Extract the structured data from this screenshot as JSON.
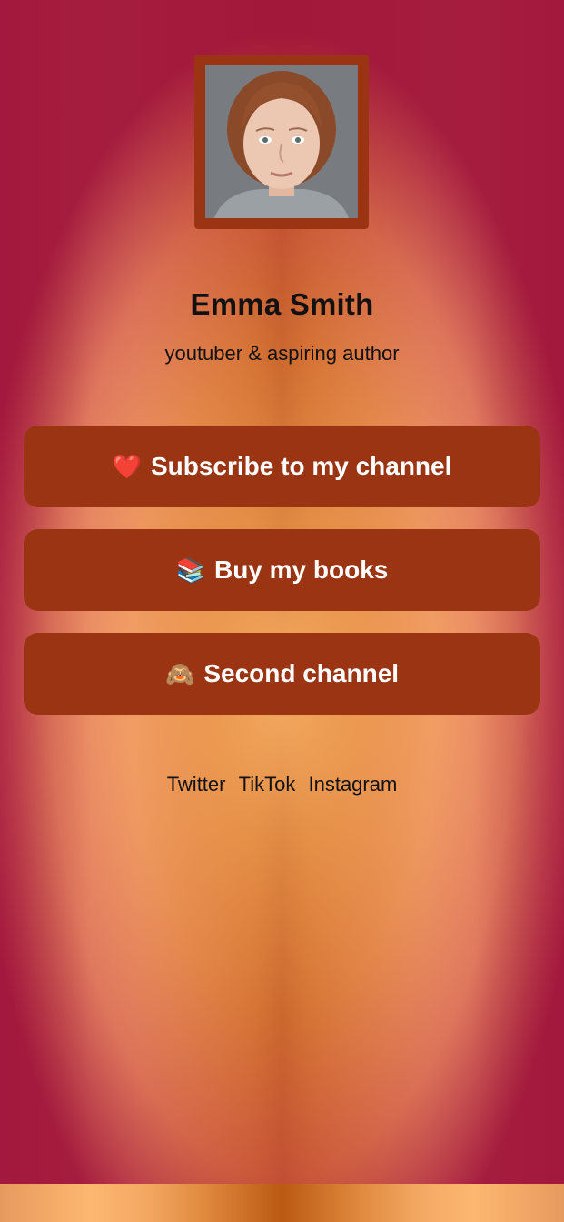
{
  "profile": {
    "name": "Emma Smith",
    "bio": "youtuber & aspiring author",
    "avatar_alt": "Emma Smith"
  },
  "links": [
    {
      "emoji": "❤️",
      "label": "Subscribe to my channel"
    },
    {
      "emoji": "📚",
      "label": "Buy my books"
    },
    {
      "emoji": "🙈",
      "label": "Second channel"
    }
  ],
  "socials": [
    "Twitter",
    "TikTok",
    "Instagram"
  ],
  "colors": {
    "button_bg": "#9a3412",
    "button_text": "#ffffff",
    "text": "#111111",
    "avatar_frame": "#9a3412"
  }
}
